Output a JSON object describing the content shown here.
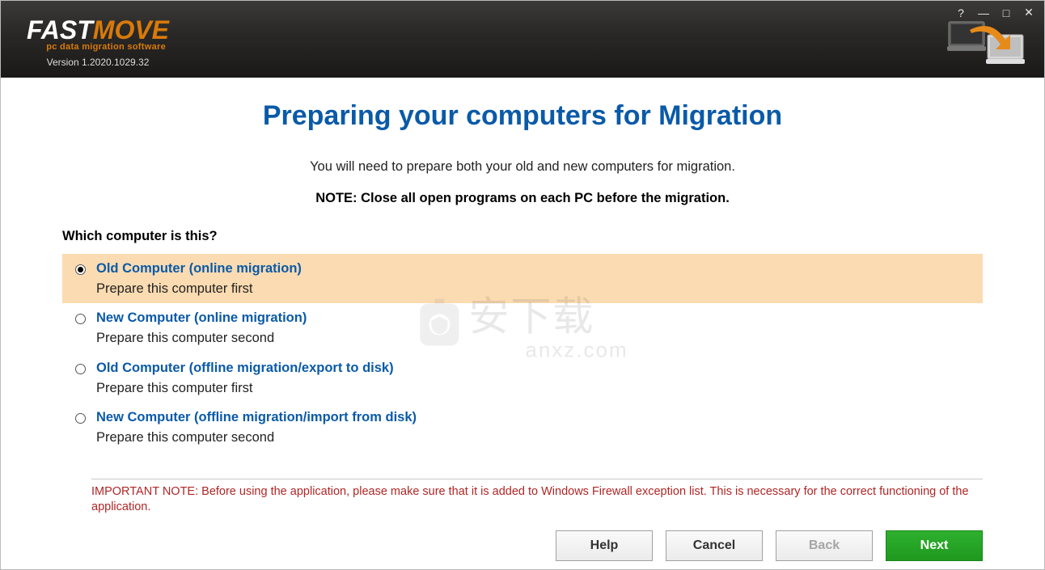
{
  "header": {
    "logo_fast": "FAST",
    "logo_move": "MOVE",
    "tagline": "pc data migration software",
    "version": "Version 1.2020.1029.32"
  },
  "page": {
    "title": "Preparing your computers for Migration",
    "intro": "You will need to prepare both your old and new computers for migration.",
    "note": "NOTE: Close all open programs on each PC before the migration.",
    "prompt": "Which computer is this?"
  },
  "options": [
    {
      "label": "Old Computer (online migration)",
      "desc": "Prepare this computer first",
      "selected": true
    },
    {
      "label": "New Computer (online migration)",
      "desc": "Prepare this computer second",
      "selected": false
    },
    {
      "label": "Old Computer (offline migration/export to disk)",
      "desc": "Prepare this computer first",
      "selected": false
    },
    {
      "label": "New Computer (offline migration/import from disk)",
      "desc": "Prepare this computer second",
      "selected": false
    }
  ],
  "warning": "IMPORTANT NOTE: Before using the application, please make sure that it is added to Windows Firewall exception list. This is necessary for the correct functioning of the application.",
  "buttons": {
    "help": "Help",
    "cancel": "Cancel",
    "back": "Back",
    "next": "Next"
  },
  "watermark": {
    "main": "安下载",
    "sub": "anxz.com"
  }
}
